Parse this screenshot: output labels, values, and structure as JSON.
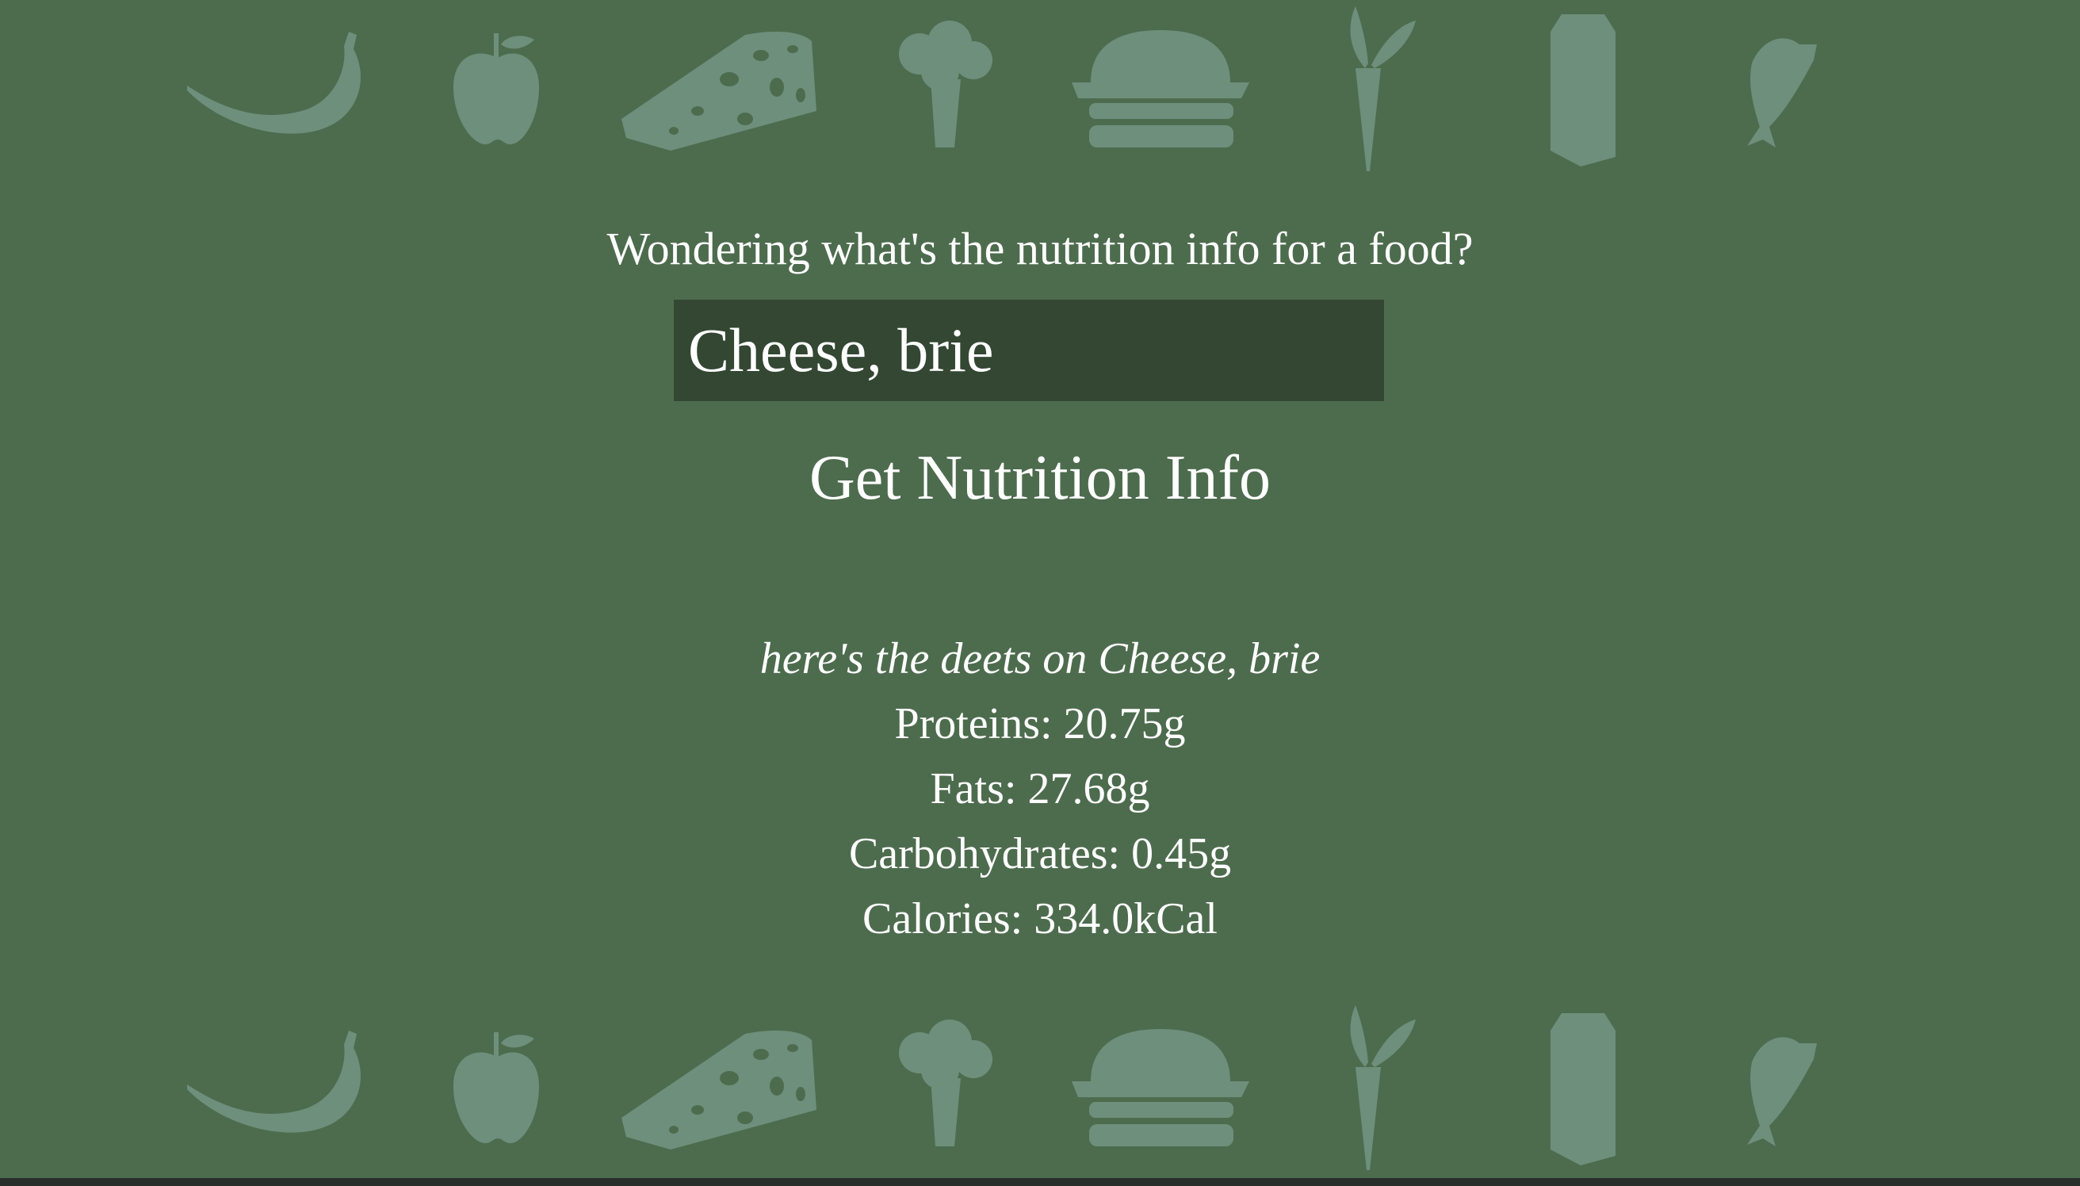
{
  "decor": {
    "icons": [
      "banana-icon",
      "apple-icon",
      "cheese-icon",
      "broccoli-icon",
      "burger-icon",
      "carrot-icon",
      "milk-carton-icon",
      "fish-icon"
    ],
    "icon_color": "#6e8f7c"
  },
  "colors": {
    "background": "#4d6c4e",
    "input_background": "#334733",
    "text": "#ffffff"
  },
  "prompt": "Wondering what's the nutrition info for a food?",
  "search": {
    "value": "Cheese, brie",
    "placeholder": ""
  },
  "button_label": "Get Nutrition Info",
  "results": {
    "heading": "here's the deets on Cheese, brie",
    "proteins": "Proteins: 20.75g",
    "fats": "Fats: 27.68g",
    "carbohydrates": "Carbohydrates: 0.45g",
    "calories": "Calories: 334.0kCal"
  }
}
